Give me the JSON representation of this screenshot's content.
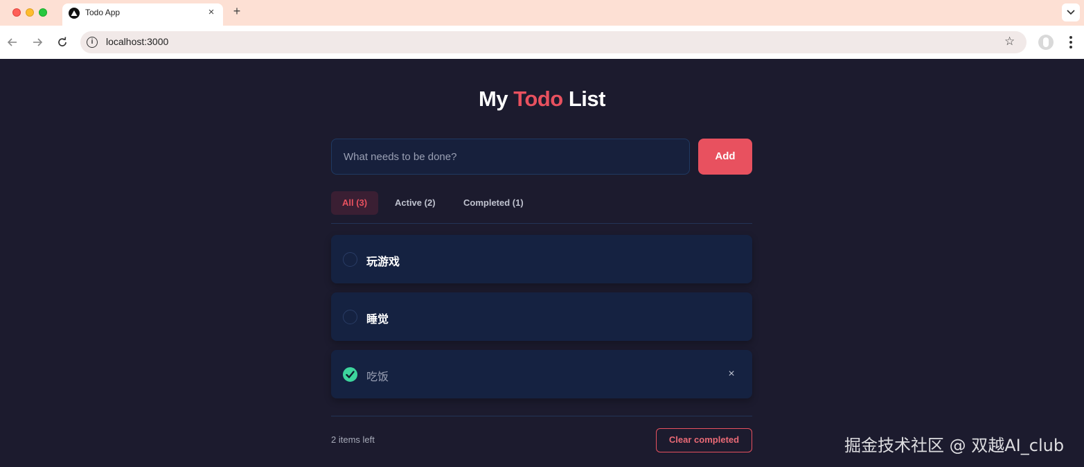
{
  "browser": {
    "tab_title": "Todo App",
    "tab_close": "×",
    "new_tab": "+",
    "url": "localhost:3000",
    "icons": [
      "favicon-triangle",
      "back-icon",
      "forward-icon",
      "reload-icon",
      "info-icon",
      "star-icon",
      "profile-icon",
      "menu-icon",
      "chevron-down-icon"
    ]
  },
  "app": {
    "title_prefix": "My",
    "title_accent": "Todo",
    "title_suffix": "List",
    "accent_color": "#e8515f",
    "input_placeholder": "What needs to be done?",
    "add_label": "Add",
    "filters": [
      {
        "label": "All (3)",
        "active": true
      },
      {
        "label": "Active (2)",
        "active": false
      },
      {
        "label": "Completed (1)",
        "active": false
      }
    ],
    "todos": [
      {
        "text": "玩游戏",
        "completed": false
      },
      {
        "text": "睡觉",
        "completed": false
      },
      {
        "text": "吃饭",
        "completed": true,
        "delete_symbol": "×"
      }
    ],
    "items_left": "2 items left",
    "clear_label": "Clear completed"
  },
  "watermark": "掘金技术社区 @ 双越AI_club"
}
